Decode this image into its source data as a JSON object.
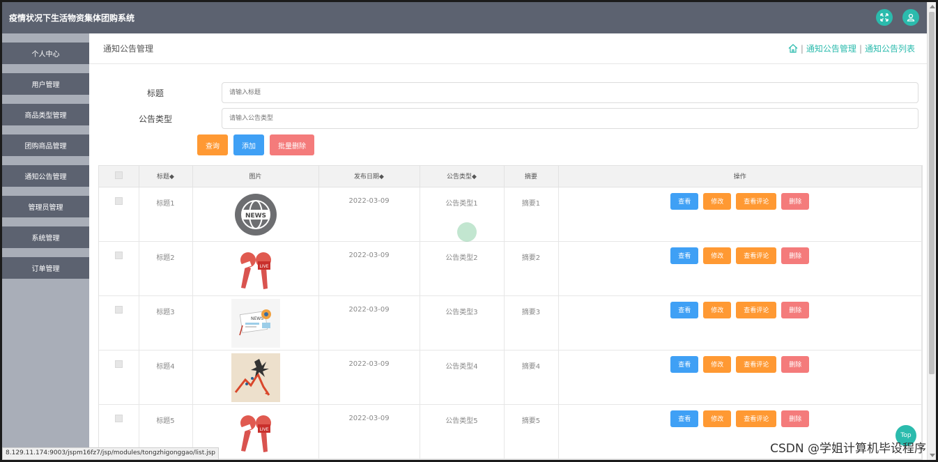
{
  "app": {
    "title": "疫情状况下生活物资集体团购系统"
  },
  "sidebar": {
    "items": [
      {
        "label": "个人中心"
      },
      {
        "label": "用户管理"
      },
      {
        "label": "商品类型管理"
      },
      {
        "label": "团购商品管理"
      },
      {
        "label": "通知公告管理"
      },
      {
        "label": "管理员管理"
      },
      {
        "label": "系统管理"
      },
      {
        "label": "订单管理"
      }
    ]
  },
  "header": {
    "page_title": "通知公告管理",
    "breadcrumb": [
      "通知公告管理",
      "通知公告列表"
    ],
    "separator": "|"
  },
  "search": {
    "title_label": "标题",
    "title_placeholder": "请输入标题",
    "type_label": "公告类型",
    "type_placeholder": "请输入公告类型"
  },
  "buttons": {
    "query": "查询",
    "add": "添加",
    "batch_delete": "批量删除"
  },
  "table": {
    "headers": {
      "title": "标题◆",
      "image": "图片",
      "date": "发布日期◆",
      "type": "公告类型◆",
      "summary": "摘要",
      "actions": "操作"
    },
    "rows": [
      {
        "title": "标题1",
        "date": "2022-03-09",
        "type": "公告类型1",
        "summary": "摘要1",
        "image_icon": "news-globe-icon"
      },
      {
        "title": "标题2",
        "date": "2022-03-09",
        "type": "公告类型2",
        "summary": "摘要2",
        "image_icon": "live-microphone-icon"
      },
      {
        "title": "标题3",
        "date": "2022-03-09",
        "type": "公告类型3",
        "summary": "摘要3",
        "image_icon": "newspaper-icon"
      },
      {
        "title": "标题4",
        "date": "2022-03-09",
        "type": "公告类型4",
        "summary": "摘要4",
        "image_icon": "stock-chart-icon"
      },
      {
        "title": "标题5",
        "date": "2022-03-09",
        "type": "公告类型5",
        "summary": "摘要5",
        "image_icon": "live-microphone-icon"
      }
    ],
    "row_actions": {
      "view": "查看",
      "edit": "修改",
      "view_comments": "查看评论",
      "delete": "删除"
    }
  },
  "status_bar": {
    "url": "8.129.11.174:9003/jspm16fz7/jsp/modules/tongzhigonggao/list.jsp"
  },
  "back_to_top": "Top",
  "watermark": "CSDN @学姐计算机毕设程序",
  "colors": {
    "topbar": "#5c6270",
    "accent": "#2bbbad",
    "orange": "#ff9933",
    "blue": "#3fa0f5",
    "red": "#f47b7b"
  }
}
